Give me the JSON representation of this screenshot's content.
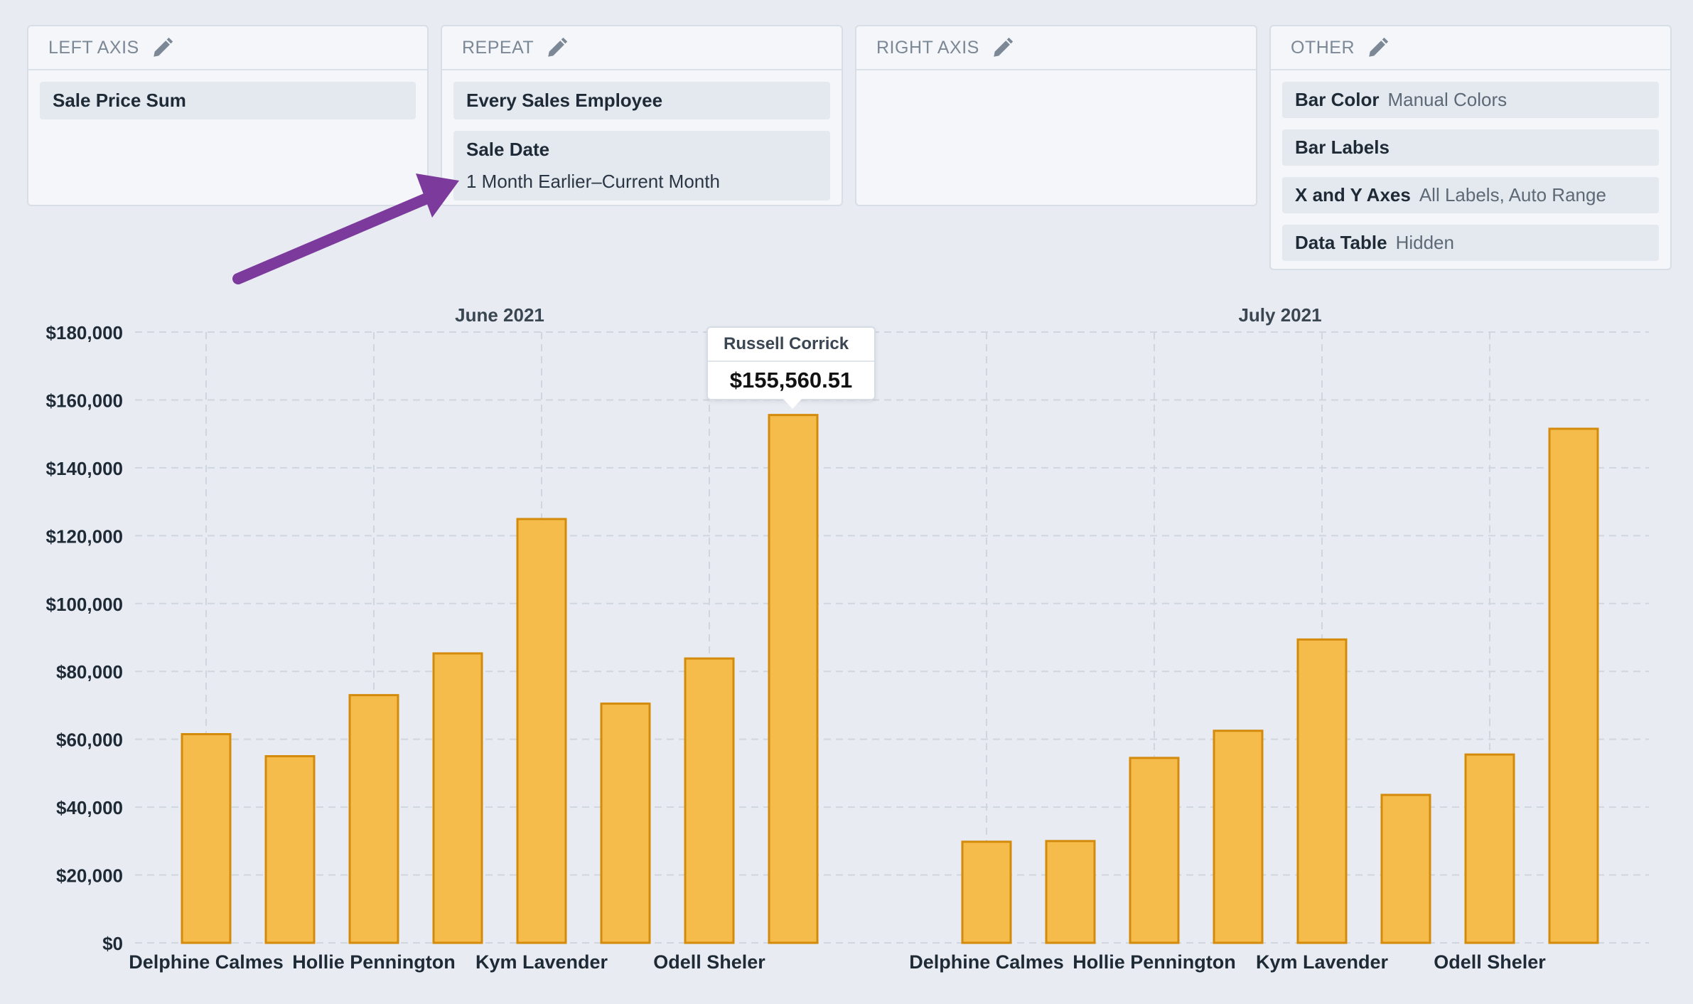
{
  "panels": {
    "left_axis": {
      "title": "LEFT AXIS",
      "chips": [
        {
          "label": "Sale Price Sum"
        }
      ]
    },
    "repeat": {
      "title": "REPEAT",
      "chips": [
        {
          "label": "Every Sales Employee"
        },
        {
          "label": "Sale Date",
          "detail": "1 Month Earlier–Current Month"
        }
      ]
    },
    "right_axis": {
      "title": "RIGHT AXIS"
    },
    "other": {
      "title": "OTHER",
      "chips": [
        {
          "label": "Bar Color",
          "value": "Manual Colors"
        },
        {
          "label": "Bar Labels",
          "value": ""
        },
        {
          "label": "X and Y Axes",
          "value": "All Labels, Auto Range"
        },
        {
          "label": "Data Table",
          "value": "Hidden"
        }
      ]
    }
  },
  "tooltip": {
    "name": "Russell Corrick",
    "value": "$155,560.51"
  },
  "colors": {
    "bar_fill": "#f5bc4c",
    "bar_stroke": "#d48b0b",
    "arrow": "#7b3a9c"
  },
  "chart_data": {
    "type": "bar",
    "ylim": [
      0,
      180000
    ],
    "yticks": [
      "$0",
      "$20,000",
      "$40,000",
      "$60,000",
      "$80,000",
      "$100,000",
      "$120,000",
      "$140,000",
      "$160,000",
      "$180,000"
    ],
    "ytick_values": [
      0,
      20000,
      40000,
      60000,
      80000,
      100000,
      120000,
      140000,
      160000,
      180000
    ],
    "grid": true,
    "facets": [
      {
        "title": "June 2021",
        "xticklabels": [
          "Delphine Calmes",
          "Hollie Pennington",
          "Kym Lavender",
          "Odell Sheler"
        ],
        "values": [
          61500,
          55000,
          73000,
          85300,
          124900,
          70500,
          83800,
          155560.51
        ]
      },
      {
        "title": "July 2021",
        "xticklabels": [
          "Delphine Calmes",
          "Hollie Pennington",
          "Kym Lavender",
          "Odell Sheler"
        ],
        "values": [
          29800,
          30000,
          54500,
          62500,
          89400,
          43600,
          55500,
          151500
        ]
      }
    ]
  }
}
